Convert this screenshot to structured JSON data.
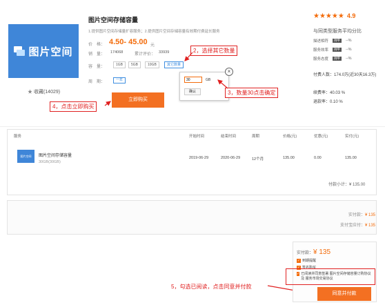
{
  "product": {
    "logo_text": "图片空间",
    "title": "图片空间存储容量",
    "description": "1.提供图片空间存储量扩容服务；2.提供图片空间存储容量有效期付费延长服务",
    "favorites": "收藏(14029)",
    "price_label": "价　格：",
    "price": "4.50- 45.00",
    "price_unit": "元",
    "sales_label": "销　量：",
    "sales_value": "174068",
    "cumulative_label": "累计评价：",
    "cumulative_value": "33939",
    "capacity_label": "容　量：",
    "capacity_options": [
      "1GB",
      "5GB",
      "10GB",
      "其它数量"
    ],
    "period_label": "周　期：",
    "period_value": "一年",
    "buy_button": "立即购买"
  },
  "popup": {
    "quantity_value": "30",
    "unit": "GB",
    "confirm": "确认",
    "close": "×"
  },
  "annotations": {
    "step2": "2，选择其它数量",
    "step3": "3，数量30点击确定",
    "step4": "4，点击立即购买",
    "step5": "5，勾选已阅读，点击同意并付款"
  },
  "rating": {
    "stars": "★★★★★",
    "score": "4.9",
    "peer_label": "与同类型服务平均分比",
    "rows": [
      {
        "label": "描述相符",
        "badge": "持平",
        "value": "--%"
      },
      {
        "label": "服务效率",
        "badge": "持平",
        "value": "--%"
      },
      {
        "label": "服务态度",
        "badge": "持平",
        "value": "--%"
      }
    ],
    "stats": [
      {
        "label": "付费人数：",
        "value": "174.0万(近30天16.3万)"
      },
      {
        "label": "续费率：",
        "value": "40.03 %"
      },
      {
        "label": "退款率：",
        "value": "0.10 %"
      }
    ]
  },
  "order": {
    "headers": [
      "服务",
      "开始时间",
      "结束时间",
      "周期",
      "价格(元)",
      "优惠(元)",
      "实付(元)"
    ],
    "row": {
      "img_text": "图片空间",
      "name": "图片空间存储容量",
      "spec": "30GB(30GB)",
      "start": "2019-06-29",
      "end": "2020-06-29",
      "period": "12个月",
      "price": "135.00",
      "discount": "0.00",
      "paid": "135.00"
    },
    "subtotal_label": "付款小计：",
    "subtotal_value": "¥ 135.00"
  },
  "summary": {
    "paid_label": "实付款：",
    "paid_value": "¥ 135",
    "refund_label": "支付宝应付：",
    "refund_value": "¥ 135"
  },
  "checkout": {
    "paid_label": "实付款：",
    "paid_value": "¥ 135",
    "opt1": "到期提醒",
    "opt2": "签名购买",
    "agree_text": "已阅读并同意签署 图片空间存储容量订购协议 及 服务市场交易协议",
    "agree_button": "同意并付款"
  },
  "colors": {
    "accent": "#f37022",
    "annotation": "#e02020",
    "product_blue": "#3f86d8"
  }
}
